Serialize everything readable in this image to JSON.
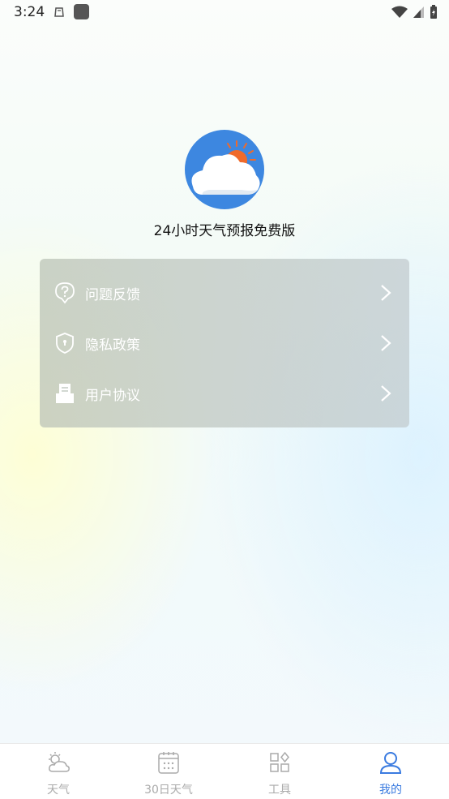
{
  "status_bar": {
    "time": "3:24"
  },
  "app": {
    "name": "24小时天气预报免费版"
  },
  "menu": {
    "items": [
      {
        "label": "问题反馈",
        "icon": "question-icon"
      },
      {
        "label": "隐私政策",
        "icon": "shield-icon"
      },
      {
        "label": "用户协议",
        "icon": "document-icon"
      }
    ]
  },
  "tabs": [
    {
      "label": "天气",
      "icon": "weather-icon",
      "active": false
    },
    {
      "label": "30日天气",
      "icon": "calendar-icon",
      "active": false
    },
    {
      "label": "工具",
      "icon": "tools-icon",
      "active": false
    },
    {
      "label": "我的",
      "icon": "profile-icon",
      "active": true
    }
  ],
  "colors": {
    "accent": "#3a7be0",
    "logo_bg": "#3d87e0",
    "sun": "#f06a2a"
  }
}
